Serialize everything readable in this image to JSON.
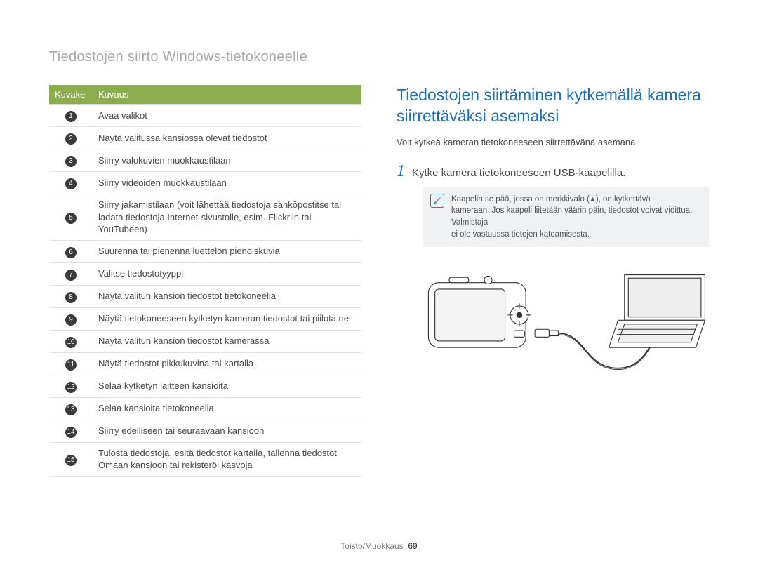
{
  "header": "Tiedostojen siirto Windows-tietokoneelle",
  "table": {
    "headers": {
      "icon": "Kuvake",
      "desc": "Kuvaus"
    },
    "rows": [
      {
        "n": "1",
        "desc": "Avaa valikot"
      },
      {
        "n": "2",
        "desc": "Näytä valitussa kansiossa olevat tiedostot"
      },
      {
        "n": "3",
        "desc": "Siirry valokuvien muokkaustilaan"
      },
      {
        "n": "4",
        "desc": "Siirry videoiden muokkaustilaan"
      },
      {
        "n": "5",
        "desc": "Siirry jakamistilaan (voit lähettää tiedostoja sähköpostitse tai ladata tiedostoja Internet-sivustolle, esim. Flickriin tai YouTubeen)"
      },
      {
        "n": "6",
        "desc": "Suurenna tai pienennä luettelon pienoiskuvia"
      },
      {
        "n": "7",
        "desc": "Valitse tiedostotyyppi"
      },
      {
        "n": "8",
        "desc": "Näytä valitun kansion tiedostot tietokoneella"
      },
      {
        "n": "9",
        "desc": "Näytä tietokoneeseen kytketyn kameran tiedostot tai piilota ne"
      },
      {
        "n": "10",
        "desc": "Näytä valitun kansion tiedostot kamerassa"
      },
      {
        "n": "11",
        "desc": "Näytä tiedostot pikkukuvina tai kartalla"
      },
      {
        "n": "12",
        "desc": "Selaa kytketyn laitteen kansioita"
      },
      {
        "n": "13",
        "desc": "Selaa kansioita tietokoneella"
      },
      {
        "n": "14",
        "desc": "Siirry edelliseen tai seuraavaan kansioon"
      },
      {
        "n": "15",
        "desc": "Tulosta tiedostoja, esitä tiedostot kartalla, tallenna tiedostot Omaan kansioon tai rekisteröi kasvoja"
      }
    ]
  },
  "right": {
    "title": "Tiedostojen siirtäminen kytkemällä kamera siirrettäväksi asemaksi",
    "subtitle": "Voit kytkeä kameran tietokoneeseen siirrettävänä asemana.",
    "step1_num": "1",
    "step1_text": "Kytke kamera tietokoneeseen USB-kaapelilla.",
    "note_line1a": "Kaapelin se pää, jossa on merkkivalo (",
    "note_line1b": "), on kytkettävä",
    "note_line2": "kameraan. Jos kaapeli liitetään väärin päin, tiedostot voivat vioittua.",
    "note_line3": "Valmistaja",
    "note_line4": "ei ole vastuussa tietojen katoamisesta."
  },
  "footer": {
    "section": "Toisto/Muokkaus",
    "page": "69"
  }
}
